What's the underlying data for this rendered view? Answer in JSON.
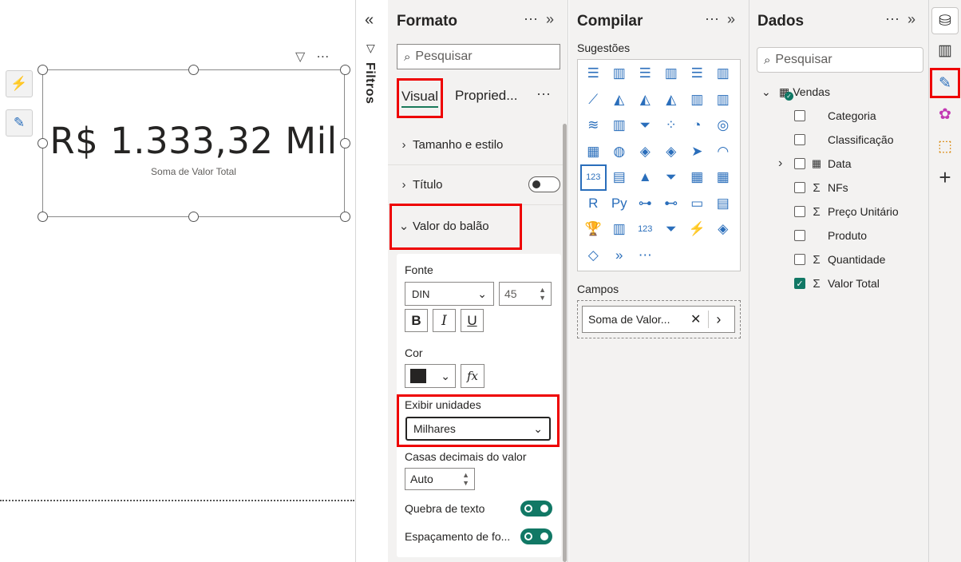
{
  "canvas": {
    "card_value": "R$ 1.333,32 Mil",
    "card_subtitle": "Soma de Valor Total",
    "toolbar_more": "⋯"
  },
  "filtros": {
    "collapse_glyph": "«",
    "label": "Filtros"
  },
  "formato": {
    "title": "Formato",
    "more": "⋯",
    "expand": "»",
    "search_placeholder": "Pesquisar",
    "tabs": [
      {
        "label": "Visual"
      },
      {
        "label": "Propried..."
      }
    ],
    "tabs_more": "⋯",
    "sections": {
      "tamanho": "Tamanho e estilo",
      "titulo": "Título",
      "valor_balao": "Valor do balão"
    },
    "fonte_label": "Fonte",
    "font_value": "DIN",
    "font_size": "45",
    "bold": "B",
    "italic": "I",
    "underline": "U",
    "cor_label": "Cor",
    "color_swatch": "#252423",
    "fx_label": "fx",
    "exibir_unidades_label": "Exibir unidades",
    "exibir_unidades_value": "Milhares",
    "casas_label": "Casas decimais do valor",
    "casas_value": "Auto",
    "quebra_label": "Quebra de texto",
    "espacamento_label": "Espaçamento de fo..."
  },
  "compilar": {
    "title": "Compilar",
    "more": "⋯",
    "expand": "»",
    "sugestoes_label": "Sugestões",
    "viz_icons": [
      "stacked-bar-chart",
      "stacked-column-chart",
      "clustered-bar-chart",
      "clustered-column-chart",
      "100-bar-chart",
      "100-column-chart",
      "line-chart",
      "area-chart",
      "stacked-area-chart",
      "100-area-chart",
      "line-column-chart",
      "line-clustered-column-chart",
      "ribbon-chart",
      "waterfall-chart",
      "funnel-chart",
      "scatter-chart",
      "pie-chart",
      "donut-chart",
      "treemap",
      "map",
      "filled-map",
      "shape-map",
      "azure-map",
      "gauge",
      "card",
      "multi-row-card",
      "kpi",
      "slicer",
      "table",
      "matrix",
      "r-visual",
      "python-visual",
      "key-influencers",
      "decomposition-tree",
      "qa-visual",
      "paginated-report",
      "smart-narrative",
      "report-builder",
      "metrics",
      "power-apps",
      "power-automate",
      "arcgis-map",
      "get-more-visuals",
      "more-visuals",
      "more-visuals-ellipsis"
    ],
    "viz_glyphs": [
      "☰",
      "▥",
      "☰",
      "▥",
      "☰",
      "▥",
      "⟋",
      "◭",
      "◭",
      "◭",
      "▥",
      "▥",
      "≋",
      "▥",
      "⏷",
      "⁘",
      "◔",
      "◎",
      "▦",
      "◍",
      "◈",
      "◈",
      "➤",
      "◠",
      "123",
      "▤",
      "▲",
      "⏷",
      "▦",
      "▦",
      "R",
      "Py",
      "⊶",
      "⊷",
      "▭",
      "▤",
      "🏆",
      "▥",
      "123",
      "⏷",
      "⚡",
      "◈",
      "◇",
      "»",
      "⋯"
    ],
    "campos_label": "Campos",
    "field_value": "Soma de Valor...",
    "field_remove": "✕",
    "field_expand": "›"
  },
  "dados": {
    "title": "Dados",
    "more": "⋯",
    "expand": "»",
    "search_placeholder": "Pesquisar",
    "table_name": "Vendas",
    "fields": [
      {
        "label": "Categoria",
        "sigma": false,
        "checked": false,
        "expandable": false
      },
      {
        "label": "Classificação",
        "sigma": false,
        "checked": false,
        "expandable": false
      },
      {
        "label": "Data",
        "sigma": false,
        "checked": false,
        "expandable": true
      },
      {
        "label": "NFs",
        "sigma": true,
        "checked": false,
        "expandable": false
      },
      {
        "label": "Preço Unitário",
        "sigma": true,
        "checked": false,
        "expandable": false
      },
      {
        "label": "Produto",
        "sigma": false,
        "checked": false,
        "expandable": false
      },
      {
        "label": "Quantidade",
        "sigma": true,
        "checked": false,
        "expandable": false
      },
      {
        "label": "Valor Total",
        "sigma": true,
        "checked": true,
        "expandable": false
      }
    ]
  },
  "colors": {
    "highlight_red": "#ee0000",
    "toggle_on": "#117865",
    "viz_blue": "#2a6ebb",
    "pane_bg": "#f3f2f1"
  }
}
